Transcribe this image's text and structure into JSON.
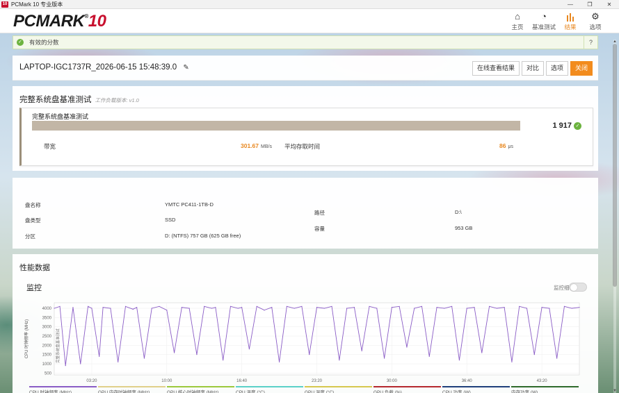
{
  "window": {
    "title": "PCMark 10 专业版本",
    "app_icon": "10"
  },
  "header": {
    "logo_main": "PCMARK",
    "logo_ten": "10",
    "logo_reg": "®",
    "nav": [
      {
        "label": "主页",
        "icon": "home-icon"
      },
      {
        "label": "基准测试",
        "icon": "gauge-icon"
      },
      {
        "label": "结果",
        "icon": "bar-chart-icon",
        "active": true
      },
      {
        "label": "选项",
        "icon": "gear-icon"
      }
    ]
  },
  "status": {
    "text": "有效的分数",
    "help": "?"
  },
  "result": {
    "title": "LAPTOP-IGC1737R_2026-06-15 15:48:39.0",
    "buttons": {
      "online": "在线查看结果",
      "compare": "对比",
      "options": "选项",
      "close": "关闭"
    }
  },
  "benchmark": {
    "title": "完整系统盘基准测试",
    "version": "工作负载版本: v1.0",
    "card_name": "完整系统盘基准测试",
    "score": "1 917",
    "bandwidth_label": "带宽",
    "bandwidth_value": "301.67",
    "bandwidth_unit": "MB/s",
    "latency_label": "平均存取时间",
    "latency_value": "86",
    "latency_unit": "μs"
  },
  "disk": {
    "name_label": "盘名称",
    "name_value": "YMTC PC411-1TB-D",
    "type_label": "盘类型",
    "type_value": "SSD",
    "partition_label": "分区",
    "partition_value": "D: (NTFS) 757 GB (625 GB free)",
    "path_label": "路径",
    "path_value": "D:\\",
    "capacity_label": "容量",
    "capacity_value": "953 GB"
  },
  "performance": {
    "title": "性能数据",
    "monitor_title": "监控",
    "toggle_label": "监控细节"
  },
  "chart_data": {
    "type": "line",
    "ylabel": "CPU 时钟频率 (MHz)",
    "annotation": "完整系统盘基准测试",
    "yticks": [
      500,
      1000,
      1500,
      2000,
      2500,
      3000,
      3500,
      4000
    ],
    "ylim": [
      400,
      4300
    ],
    "xticks": [
      "03:20",
      "10:00",
      "16:40",
      "23:20",
      "30:00",
      "36:40",
      "43:20"
    ],
    "xtick_seconds": [
      200,
      600,
      1000,
      1400,
      1800,
      2200,
      2600
    ],
    "xlim": [
      0,
      2800
    ],
    "series_color": "#8a5cc6",
    "series": [
      {
        "name": "CPU 时钟频率 (MHz)",
        "x": [
          0,
          30,
          60,
          100,
          140,
          180,
          200,
          240,
          260,
          300,
          340,
          380,
          420,
          440,
          480,
          520,
          560,
          600,
          640,
          680,
          720,
          760,
          800,
          840,
          860,
          900,
          940,
          980,
          1000,
          1040,
          1080,
          1120,
          1160,
          1200,
          1240,
          1280,
          1320,
          1360,
          1400,
          1440,
          1480,
          1520,
          1560,
          1600,
          1640,
          1680,
          1720,
          1760,
          1800,
          1840,
          1880,
          1920,
          1960,
          2000,
          2040,
          2080,
          2120,
          2160,
          2200,
          2240,
          2280,
          2320,
          2360,
          2400,
          2440,
          2480,
          2520,
          2560,
          2600,
          2640,
          2680,
          2720,
          2760,
          2800
        ],
        "values": [
          4000,
          4100,
          900,
          4050,
          1000,
          4100,
          4000,
          1400,
          4050,
          4000,
          1100,
          4100,
          3950,
          4050,
          1300,
          4000,
          4100,
          3900,
          1600,
          4050,
          4000,
          1500,
          4100,
          4000,
          4050,
          1200,
          4100,
          4000,
          4050,
          1800,
          4100,
          3900,
          4050,
          1100,
          4100,
          4000,
          4100,
          1500,
          4050,
          4000,
          4100,
          1200,
          4000,
          4050,
          1700,
          4100,
          4000,
          1300,
          4050,
          4100,
          1900,
          4000,
          4100,
          1400,
          4050,
          4000,
          4100,
          1200,
          4000,
          4050,
          1600,
          4100,
          4000,
          4050,
          1100,
          4100,
          4000,
          1500,
          4050,
          4000,
          1300,
          4100,
          4000,
          4050
        ]
      }
    ],
    "legend": [
      "CPU 时钟频率 (MHz)",
      "GPU 内存时钟频率 (MHz)",
      "GPU 核心时钟频率 (MHz)",
      "CPU 温度 (°C)",
      "GPU 温度 (°C)",
      "GPU 负载 (%)",
      "CPU 功率 (W)",
      "内存功率 (W)"
    ],
    "legend_colors": [
      "#8a5cc6",
      "#e0d08a",
      "#9cc93c",
      "#5ad1c8",
      "#d6c84e",
      "#b5282e",
      "#1f3f7a",
      "#2e6a2a"
    ]
  }
}
